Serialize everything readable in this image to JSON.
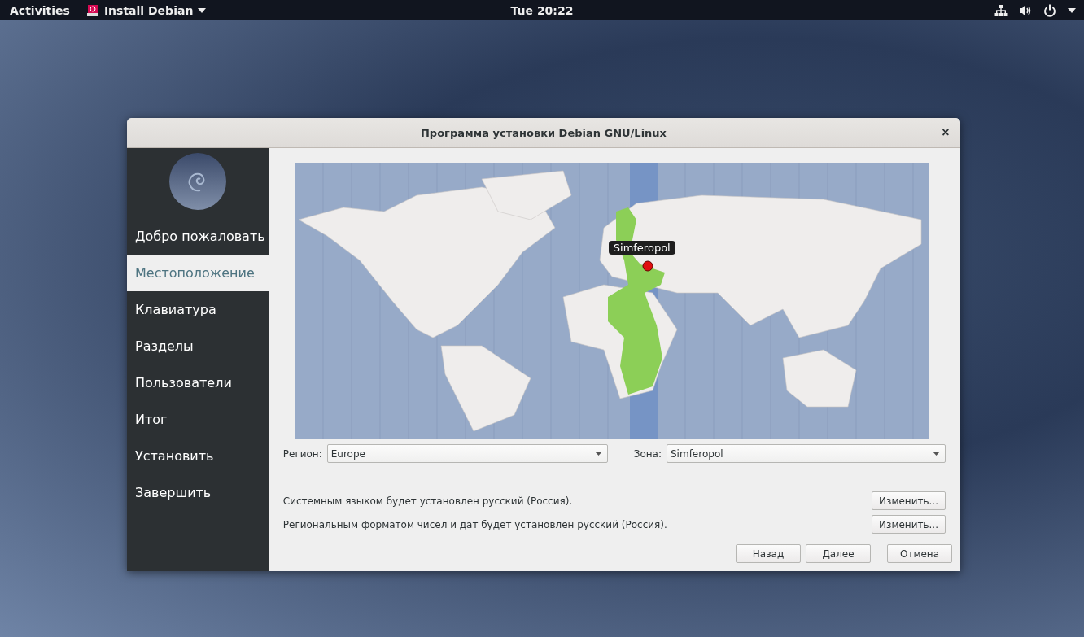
{
  "top_bar": {
    "activities": "Activities",
    "app_menu": "Install Debian",
    "clock": "Tue 20:22"
  },
  "window": {
    "title": "Программа установки Debian GNU/Linux",
    "close": "×"
  },
  "sidebar": {
    "items": [
      {
        "label": "Добро пожаловать",
        "selected": false
      },
      {
        "label": "Местоположение",
        "selected": true
      },
      {
        "label": "Клавиатура",
        "selected": false
      },
      {
        "label": "Разделы",
        "selected": false
      },
      {
        "label": "Пользователи",
        "selected": false
      },
      {
        "label": "Итог",
        "selected": false
      },
      {
        "label": "Установить",
        "selected": false
      },
      {
        "label": "Завершить",
        "selected": false
      }
    ]
  },
  "map": {
    "tooltip": "Simferopol"
  },
  "region": {
    "label": "Регион:",
    "value": "Europe"
  },
  "zone": {
    "label": "Зона:",
    "value": "Simferopol"
  },
  "locale_rows": [
    {
      "text": "Системным языком будет установлен русский (Россия).",
      "button": "Изменить..."
    },
    {
      "text": "Региональным форматом чисел и дат будет установлен русский (Россия).",
      "button": "Изменить..."
    }
  ],
  "buttons": [
    {
      "label": "Назад"
    },
    {
      "label": "Далее"
    },
    {
      "label": "Отмена"
    }
  ]
}
